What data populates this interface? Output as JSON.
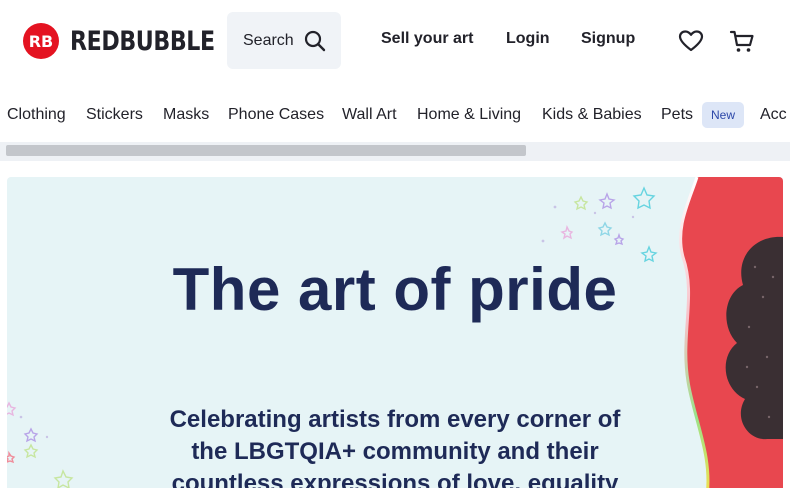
{
  "brand": {
    "name": "REDBUBBLE",
    "accent": "#e41321"
  },
  "search": {
    "placeholder": "Search"
  },
  "header": {
    "sell_label": "Sell your art",
    "login_label": "Login",
    "signup_label": "Signup",
    "favorites_icon": "heart-icon",
    "cart_icon": "cart-icon"
  },
  "categories": [
    {
      "label": "Clothing"
    },
    {
      "label": "Stickers"
    },
    {
      "label": "Masks"
    },
    {
      "label": "Phone Cases"
    },
    {
      "label": "Wall Art"
    },
    {
      "label": "Home & Living"
    },
    {
      "label": "Kids & Babies"
    },
    {
      "label": "Pets"
    },
    {
      "label": "Acc"
    }
  ],
  "pets_badge": "New",
  "hero": {
    "title": "The art of pride",
    "text": "Celebrating artists from every corner of the LBGTQIA+ community and their countless expressions of love, equality",
    "background": "#e6f4f6",
    "text_color": "#1e2a57"
  }
}
